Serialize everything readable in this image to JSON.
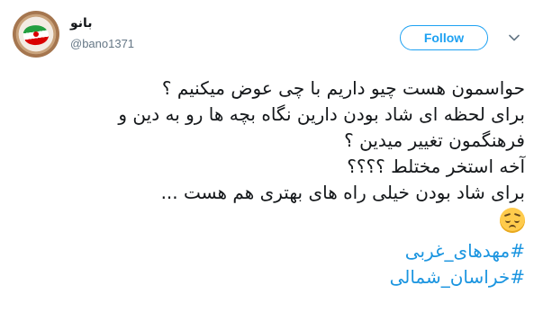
{
  "author": {
    "display_name": "بانو",
    "handle": "@bano1371",
    "avatar_icon": "iran-map-avatar-icon"
  },
  "actions": {
    "follow_label": "Follow",
    "menu_icon": "chevron-down-icon"
  },
  "tweet": {
    "lines": [
      "حواسمون هست چیو داریم با چی عوض میکنیم ؟",
      "برای لحظه ای شاد بودن دارین نگاه بچه ها رو به دین و",
      "فرهنگمون تغییر میدین ؟",
      "آخه استخر مختلط ؟؟؟؟",
      "برای شاد بودن خیلی راه های بهتری هم هست ..."
    ],
    "emoji": "pensive-face-emoji",
    "hashtags": [
      "#مهدهای_غربی",
      "#خراسان_شمالی"
    ]
  },
  "colors": {
    "accent": "#1da1f2",
    "hashtag": "#1b95e0",
    "text": "#14171a",
    "secondary": "#657786"
  }
}
